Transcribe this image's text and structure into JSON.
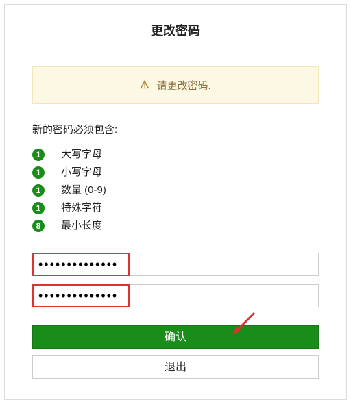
{
  "title": "更改密码",
  "alert": {
    "icon_name": "warning-icon",
    "text": "请更改密码."
  },
  "requirements": {
    "heading": "新的密码必须包含:",
    "items": [
      {
        "count": 1,
        "label": "大写字母"
      },
      {
        "count": 1,
        "label": "小写字母"
      },
      {
        "count": 1,
        "label": "数量 (0-9)"
      },
      {
        "count": 1,
        "label": "特殊字符"
      },
      {
        "count": 8,
        "label": "最小长度"
      }
    ]
  },
  "fields": {
    "new_password": {
      "value": "••••••••••••••"
    },
    "confirm_password": {
      "value": "••••••••••••••"
    }
  },
  "buttons": {
    "confirm": "确认",
    "exit": "退出"
  },
  "annotation": {
    "arrow_color": "#e03030"
  }
}
